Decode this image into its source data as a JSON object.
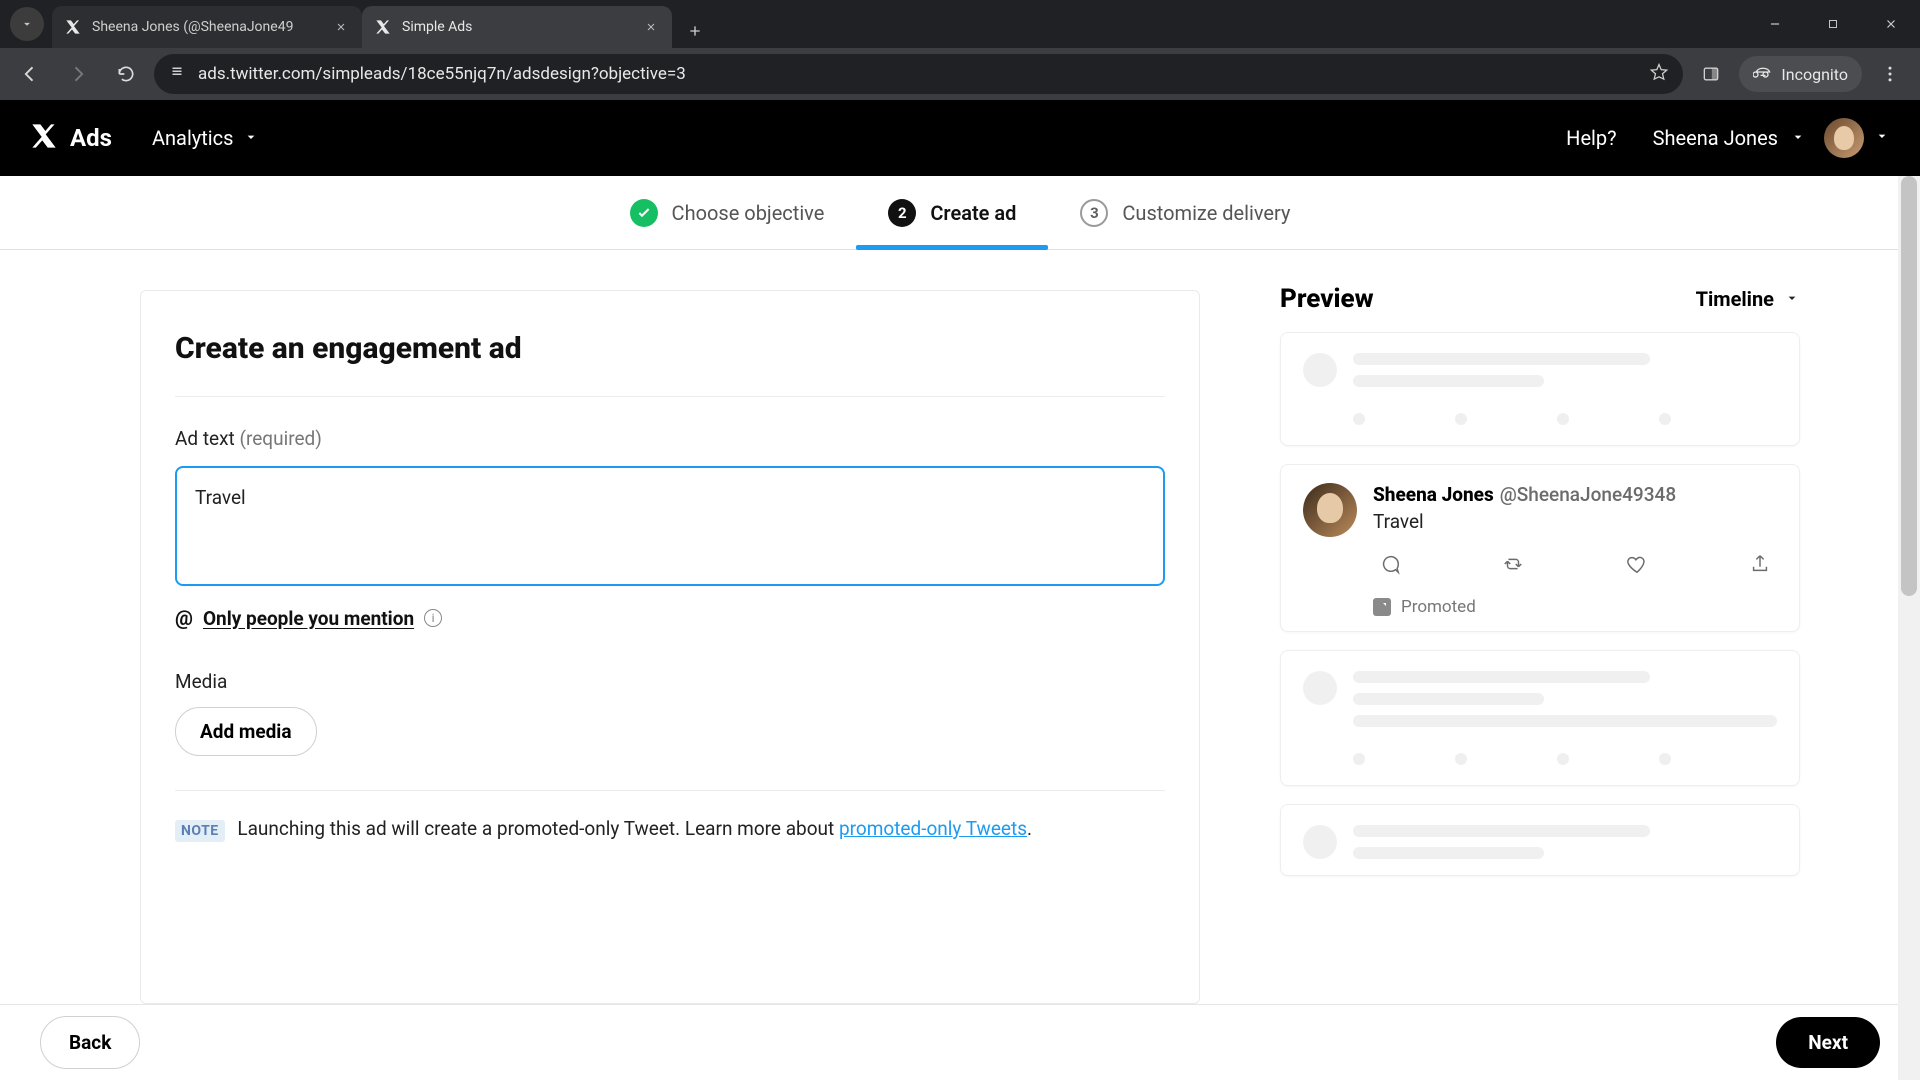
{
  "browser": {
    "tabs": [
      {
        "title": "Sheena Jones (@SheenaJone49"
      },
      {
        "title": "Simple Ads"
      }
    ],
    "url": "ads.twitter.com/simpleads/18ce55njq7n/adsdesign?objective=3",
    "incognito_label": "Incognito"
  },
  "header": {
    "brand": "Ads",
    "nav_analytics": "Analytics",
    "help": "Help?",
    "user_name": "Sheena Jones"
  },
  "stepper": {
    "step1": "Choose objective",
    "step2_num": "2",
    "step2": "Create ad",
    "step3_num": "3",
    "step3": "Customize delivery"
  },
  "form": {
    "heading": "Create an engagement ad",
    "ad_text_label": "Ad text ",
    "ad_text_hint": "(required)",
    "ad_text_value": "Travel",
    "mention_text": "Only people you mention",
    "media_label": "Media",
    "add_media": "Add media",
    "note_badge": "NOTE",
    "note_text": " Launching this ad will create a promoted-only Tweet. Learn more about ",
    "note_link": "promoted-only Tweets",
    "note_period": "."
  },
  "preview": {
    "title": "Preview",
    "scope": "Timeline",
    "tweet_name": "Sheena Jones",
    "tweet_handle": "@SheenaJone49348",
    "tweet_text": "Travel",
    "promoted": "Promoted"
  },
  "footer": {
    "back": "Back",
    "next": "Next"
  }
}
